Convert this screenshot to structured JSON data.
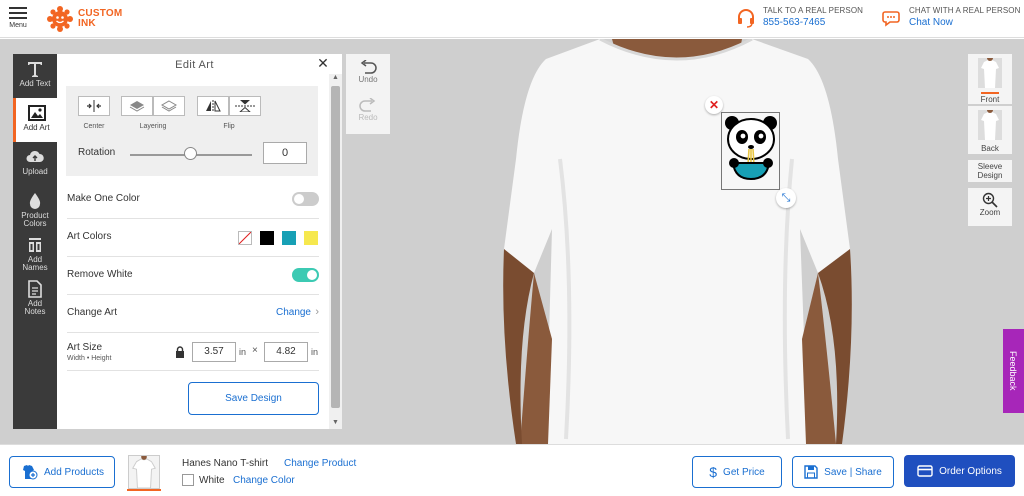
{
  "header": {
    "menu_label": "Menu",
    "logo_line1": "CUSTOM",
    "logo_line2": "INK",
    "phone": {
      "title": "TALK TO A REAL PERSON",
      "value": "855-563-7465",
      "icon": "headset-icon"
    },
    "chat": {
      "title": "CHAT WITH A REAL PERSON",
      "value": "Chat Now",
      "icon": "chat-icon"
    }
  },
  "toolbar": {
    "items": [
      {
        "label": "Add Text",
        "icon": "text-icon"
      },
      {
        "label": "Add Art",
        "icon": "image-icon",
        "active": true
      },
      {
        "label": "Upload",
        "icon": "cloud-upload-icon"
      },
      {
        "label_line1": "Product",
        "label_line2": "Colors",
        "icon": "droplet-icon"
      },
      {
        "label_line1": "Add",
        "label_line2": "Names",
        "icon": "jersey-names-icon"
      },
      {
        "label_line1": "Add",
        "label_line2": "Notes",
        "icon": "notes-icon"
      }
    ]
  },
  "panel": {
    "title": "Edit Art",
    "tools": {
      "center": "Center",
      "layering": "Layering",
      "flip": "Flip"
    },
    "rotation": {
      "label": "Rotation",
      "value": "0",
      "slider_fraction": 0.5
    },
    "make_one_color": {
      "label": "Make One Color",
      "on": false
    },
    "art_colors": {
      "label": "Art Colors",
      "swatches": [
        "none",
        "#000000",
        "#17a0b5",
        "#f6e84e"
      ]
    },
    "remove_white": {
      "label": "Remove White",
      "on": true
    },
    "change_art": {
      "label": "Change Art",
      "link": "Change"
    },
    "art_size": {
      "label": "Art Size",
      "sub": "Width • Height",
      "width": "3.57",
      "height": "4.82",
      "unit": "in",
      "times": "×"
    },
    "save_design": "Save Design"
  },
  "history": {
    "undo": "Undo",
    "redo": "Redo"
  },
  "views": {
    "front": "Front",
    "back": "Back",
    "sleeve_line1": "Sleeve",
    "sleeve_line2": "Design",
    "zoom": "Zoom"
  },
  "feedback": "Feedback",
  "footer": {
    "add_products": "Add Products",
    "product_name": "Hanes Nano T-shirt",
    "change_product": "Change Product",
    "color_name": "White",
    "change_color": "Change Color",
    "get_price": "Get Price",
    "save_share": "Save | Share",
    "order_options": "Order Options"
  },
  "colors": {
    "brand": "#f26522",
    "link": "#1a6fd1",
    "toggle_on": "#3ccab3",
    "order_btn": "#1f4fbf",
    "feedback": "#a726b9"
  }
}
